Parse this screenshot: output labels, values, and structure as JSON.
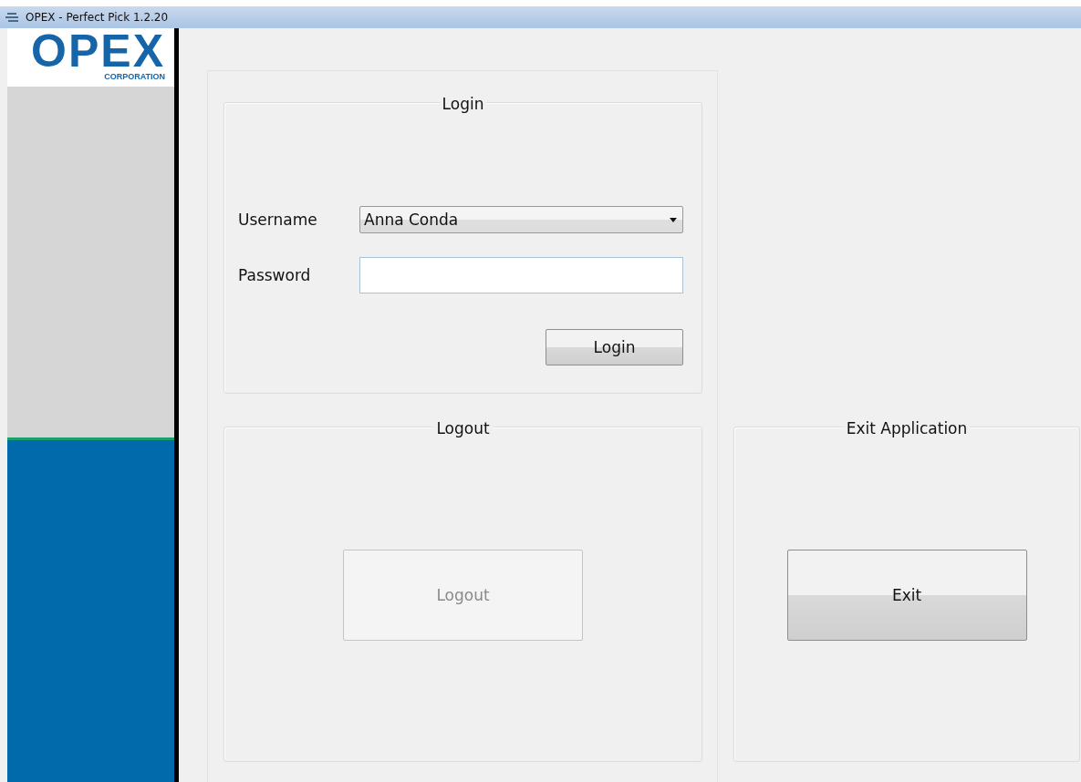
{
  "window": {
    "title": "OPEX - Perfect Pick 1.2.20"
  },
  "logo": {
    "name": "OPEX",
    "subtitle": "CORPORATION"
  },
  "login": {
    "title": "Login",
    "username_label": "Username",
    "username_value": "Anna Conda",
    "password_label": "Password",
    "button": {
      "label": "Login",
      "disabled": false
    }
  },
  "logout": {
    "title": "Logout",
    "button": {
      "label": "Logout",
      "disabled": true
    }
  },
  "exit": {
    "title": "Exit Application",
    "button": {
      "label": "Exit",
      "disabled": false
    }
  }
}
